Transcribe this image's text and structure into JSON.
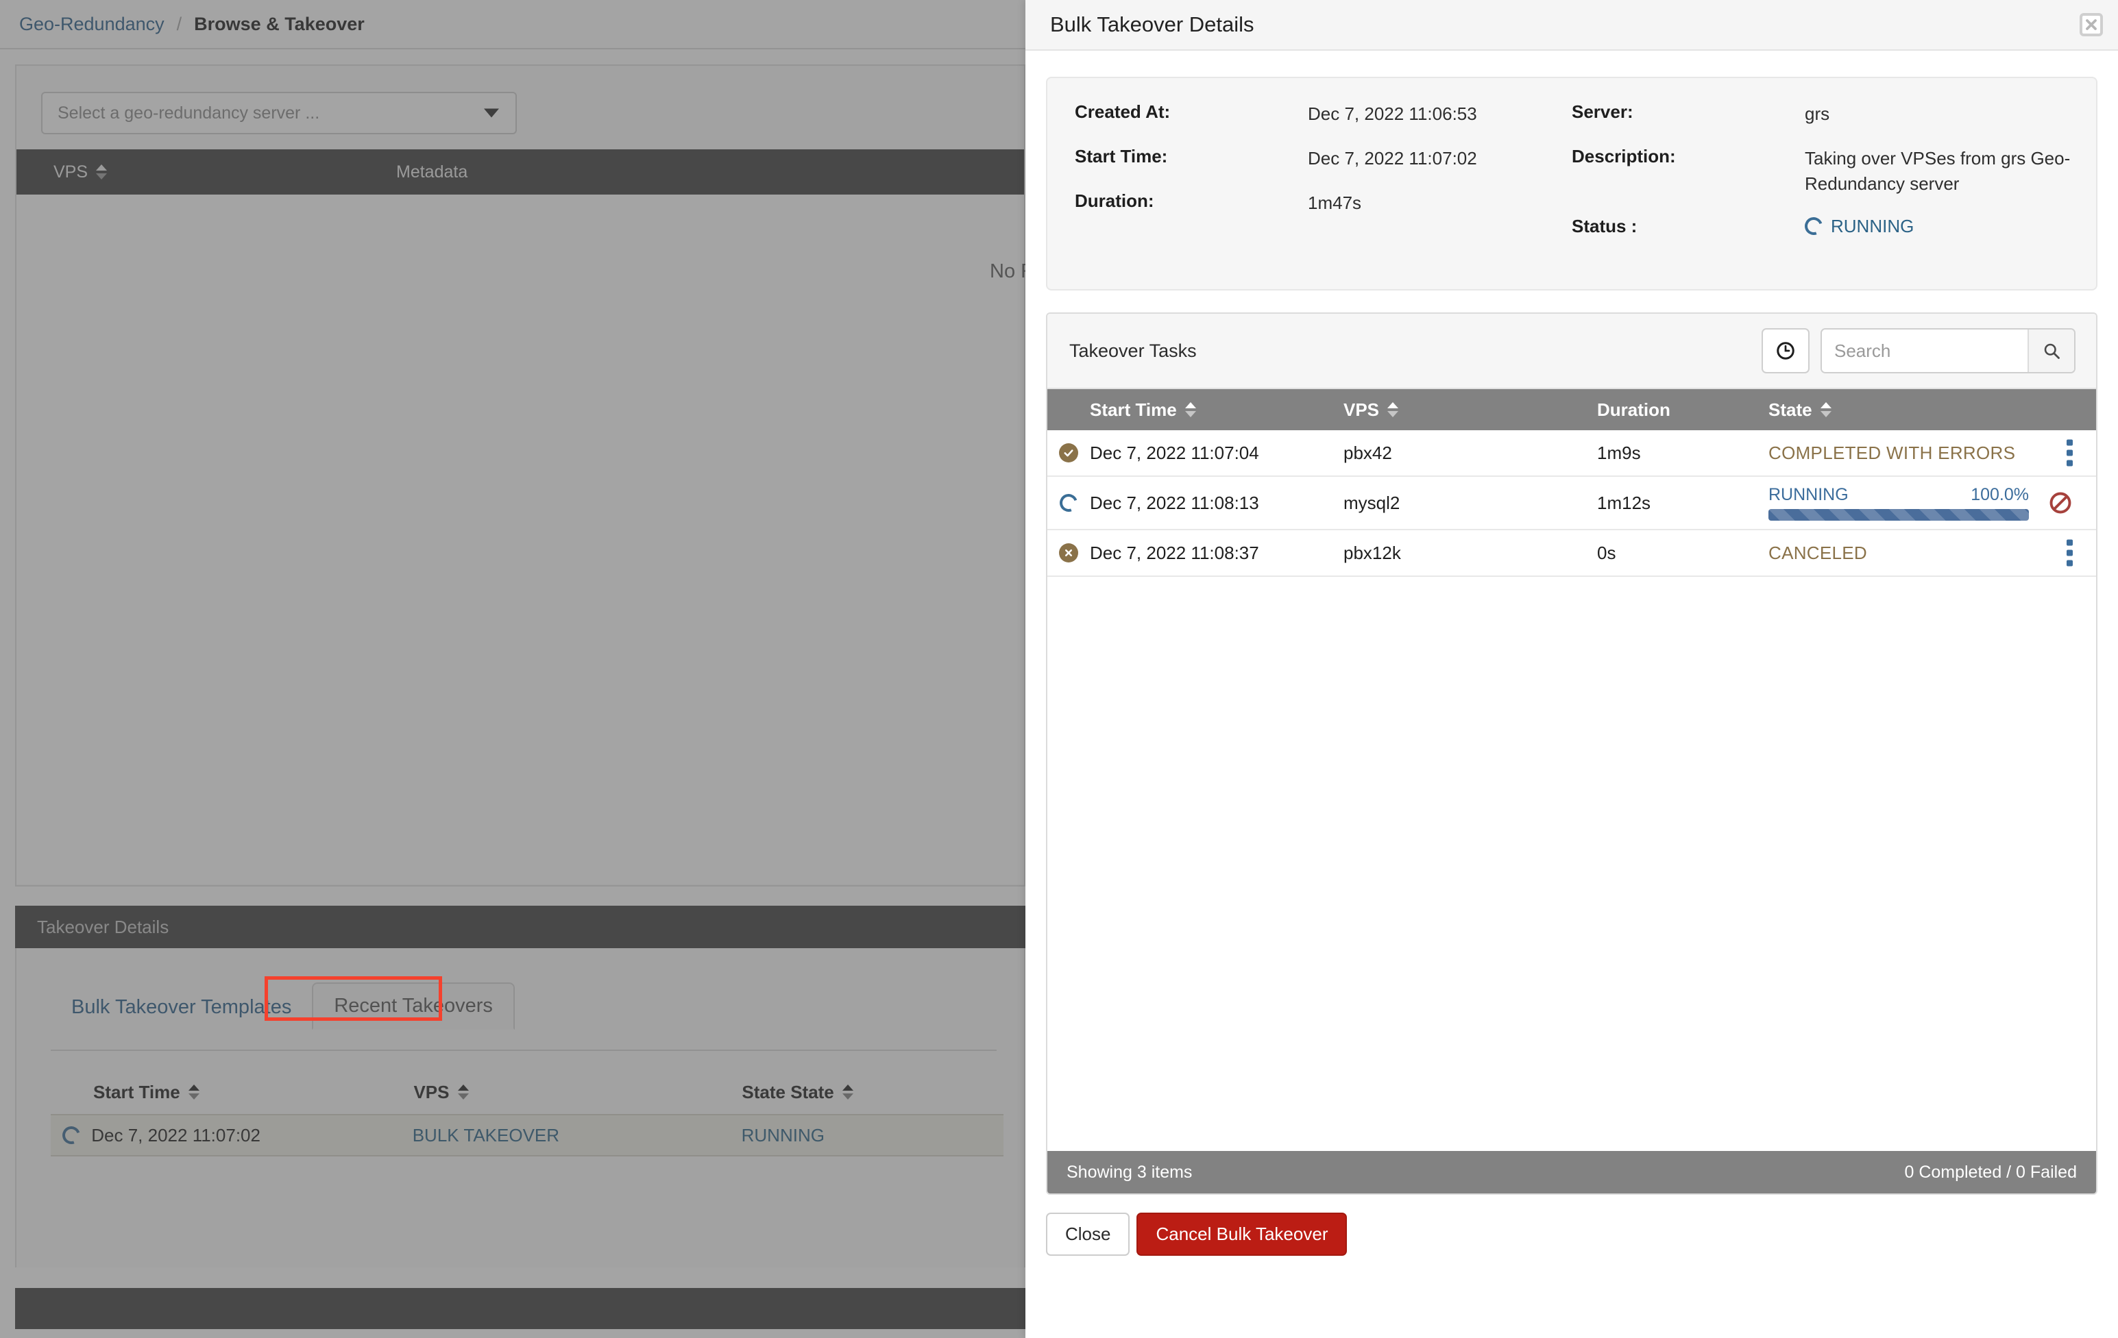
{
  "background": {
    "breadcrumb": {
      "root": "Geo-Redundancy",
      "separator": "/",
      "current": "Browse & Takeover"
    },
    "server_select": {
      "placeholder": "Select a geo-redundancy server ...",
      "caret_icon": "chevron-down-icon"
    },
    "vps_table": {
      "columns": [
        "VPS",
        "Metadata"
      ],
      "empty_text": "No Results"
    },
    "takeover_details_title": "Takeover Details",
    "tabs": [
      {
        "label": "Bulk Takeover Templates",
        "active": false
      },
      {
        "label": "Recent Takeovers",
        "active": true
      }
    ],
    "recent_takeovers": {
      "columns": [
        "Start Time",
        "VPS",
        "State State"
      ],
      "rows": [
        {
          "state_icon": "spinner-icon",
          "start_time": "Dec 7, 2022 11:07:02",
          "vps": "BULK TAKEOVER",
          "state": "RUNNING"
        }
      ]
    }
  },
  "modal": {
    "title": "Bulk Takeover Details",
    "close_icon": "close-icon",
    "info": {
      "left": [
        {
          "label": "Created At:",
          "value": "Dec 7, 2022 11:06:53"
        },
        {
          "label": "Start Time:",
          "value": "Dec 7, 2022 11:07:02"
        },
        {
          "label": "Duration:",
          "value": "1m47s"
        }
      ],
      "right": [
        {
          "label": "Server:",
          "value": "grs"
        },
        {
          "label": "Description:",
          "value": "Taking over VPSes from grs Geo-Redundancy server"
        }
      ],
      "status_label": "Status :",
      "status_value": "RUNNING",
      "status_icon": "spinner-icon"
    },
    "tasks": {
      "title": "Takeover Tasks",
      "history_icon": "clock-icon",
      "search": {
        "placeholder": "Search",
        "value": "",
        "submit_icon": "search-icon"
      },
      "columns": [
        "Start Time",
        "VPS",
        "Duration",
        "State"
      ],
      "rows": [
        {
          "status_icon": "check-circle-icon",
          "start_time": "Dec 7, 2022 11:07:04",
          "vps": "pbx42",
          "duration": "1m9s",
          "state": "COMPLETED WITH ERRORS",
          "state_kind": "warn",
          "action_icon": "kebab-menu-icon",
          "progress": null
        },
        {
          "status_icon": "spinner-icon",
          "start_time": "Dec 7, 2022 11:08:13",
          "vps": "mysql2",
          "duration": "1m12s",
          "state": "RUNNING",
          "state_kind": "running",
          "action_icon": "cancel-icon",
          "progress": {
            "percent_label": "100.0%",
            "percent": 100
          }
        },
        {
          "status_icon": "x-circle-icon",
          "start_time": "Dec 7, 2022 11:08:37",
          "vps": "pbx12k",
          "duration": "0s",
          "state": "CANCELED",
          "state_kind": "warn",
          "action_icon": "kebab-menu-icon",
          "progress": null
        }
      ],
      "footer_left": "Showing 3 items",
      "footer_right": "0 Completed / 0 Failed"
    },
    "buttons": {
      "close": "Close",
      "cancel_bulk": "Cancel Bulk Takeover"
    }
  },
  "colors": {
    "accent_blue": "#2b6286",
    "warn_brown": "#8a7249",
    "danger_red": "#bb1d14",
    "progress_blue": "#4a6d9b",
    "highlight_red": "#f5412d"
  }
}
